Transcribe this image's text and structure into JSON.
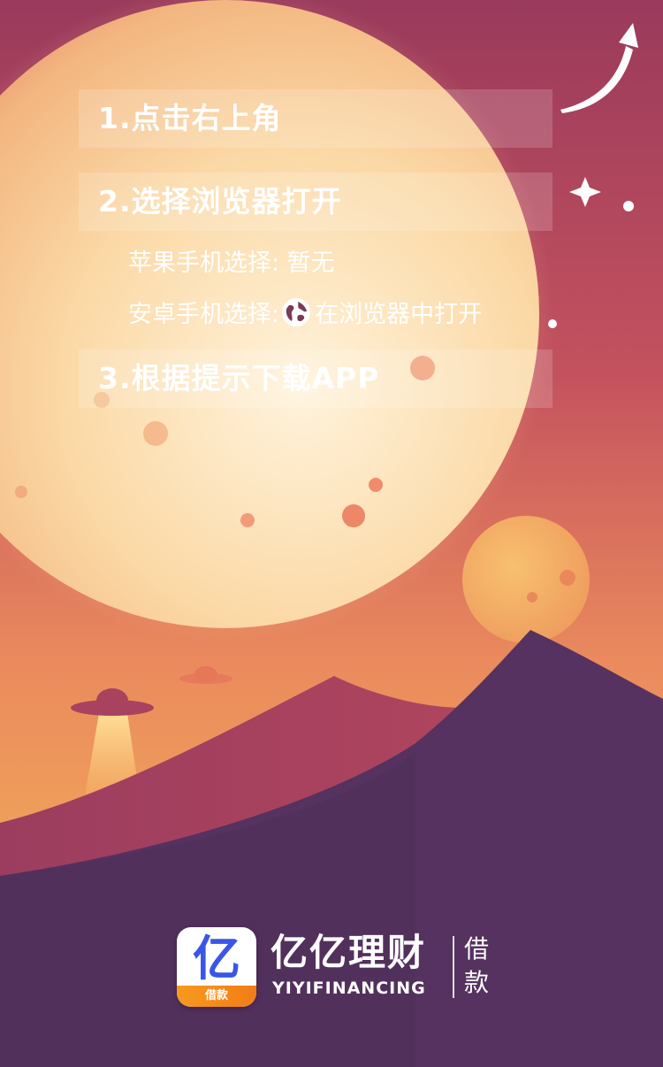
{
  "instructions": {
    "step1": "1.点击右上角",
    "step2": "2.选择浏览器打开",
    "ios_label": "苹果手机选择: 暂无",
    "android_label": "安卓手机选择:",
    "android_action": "在浏览器中打开",
    "step3": "3.根据提示下载APP"
  },
  "brand": {
    "icon_glyph": "亿",
    "icon_band": "借款",
    "name": "亿亿理财",
    "english": "YIYIFINANCING",
    "tag_line1": "借",
    "tag_line2": "款"
  },
  "colors": {
    "sky_top": "#9a3a5c",
    "sky_bottom": "#f0a15c",
    "mountain": "#55325f",
    "moon": "#fbe6c4"
  }
}
